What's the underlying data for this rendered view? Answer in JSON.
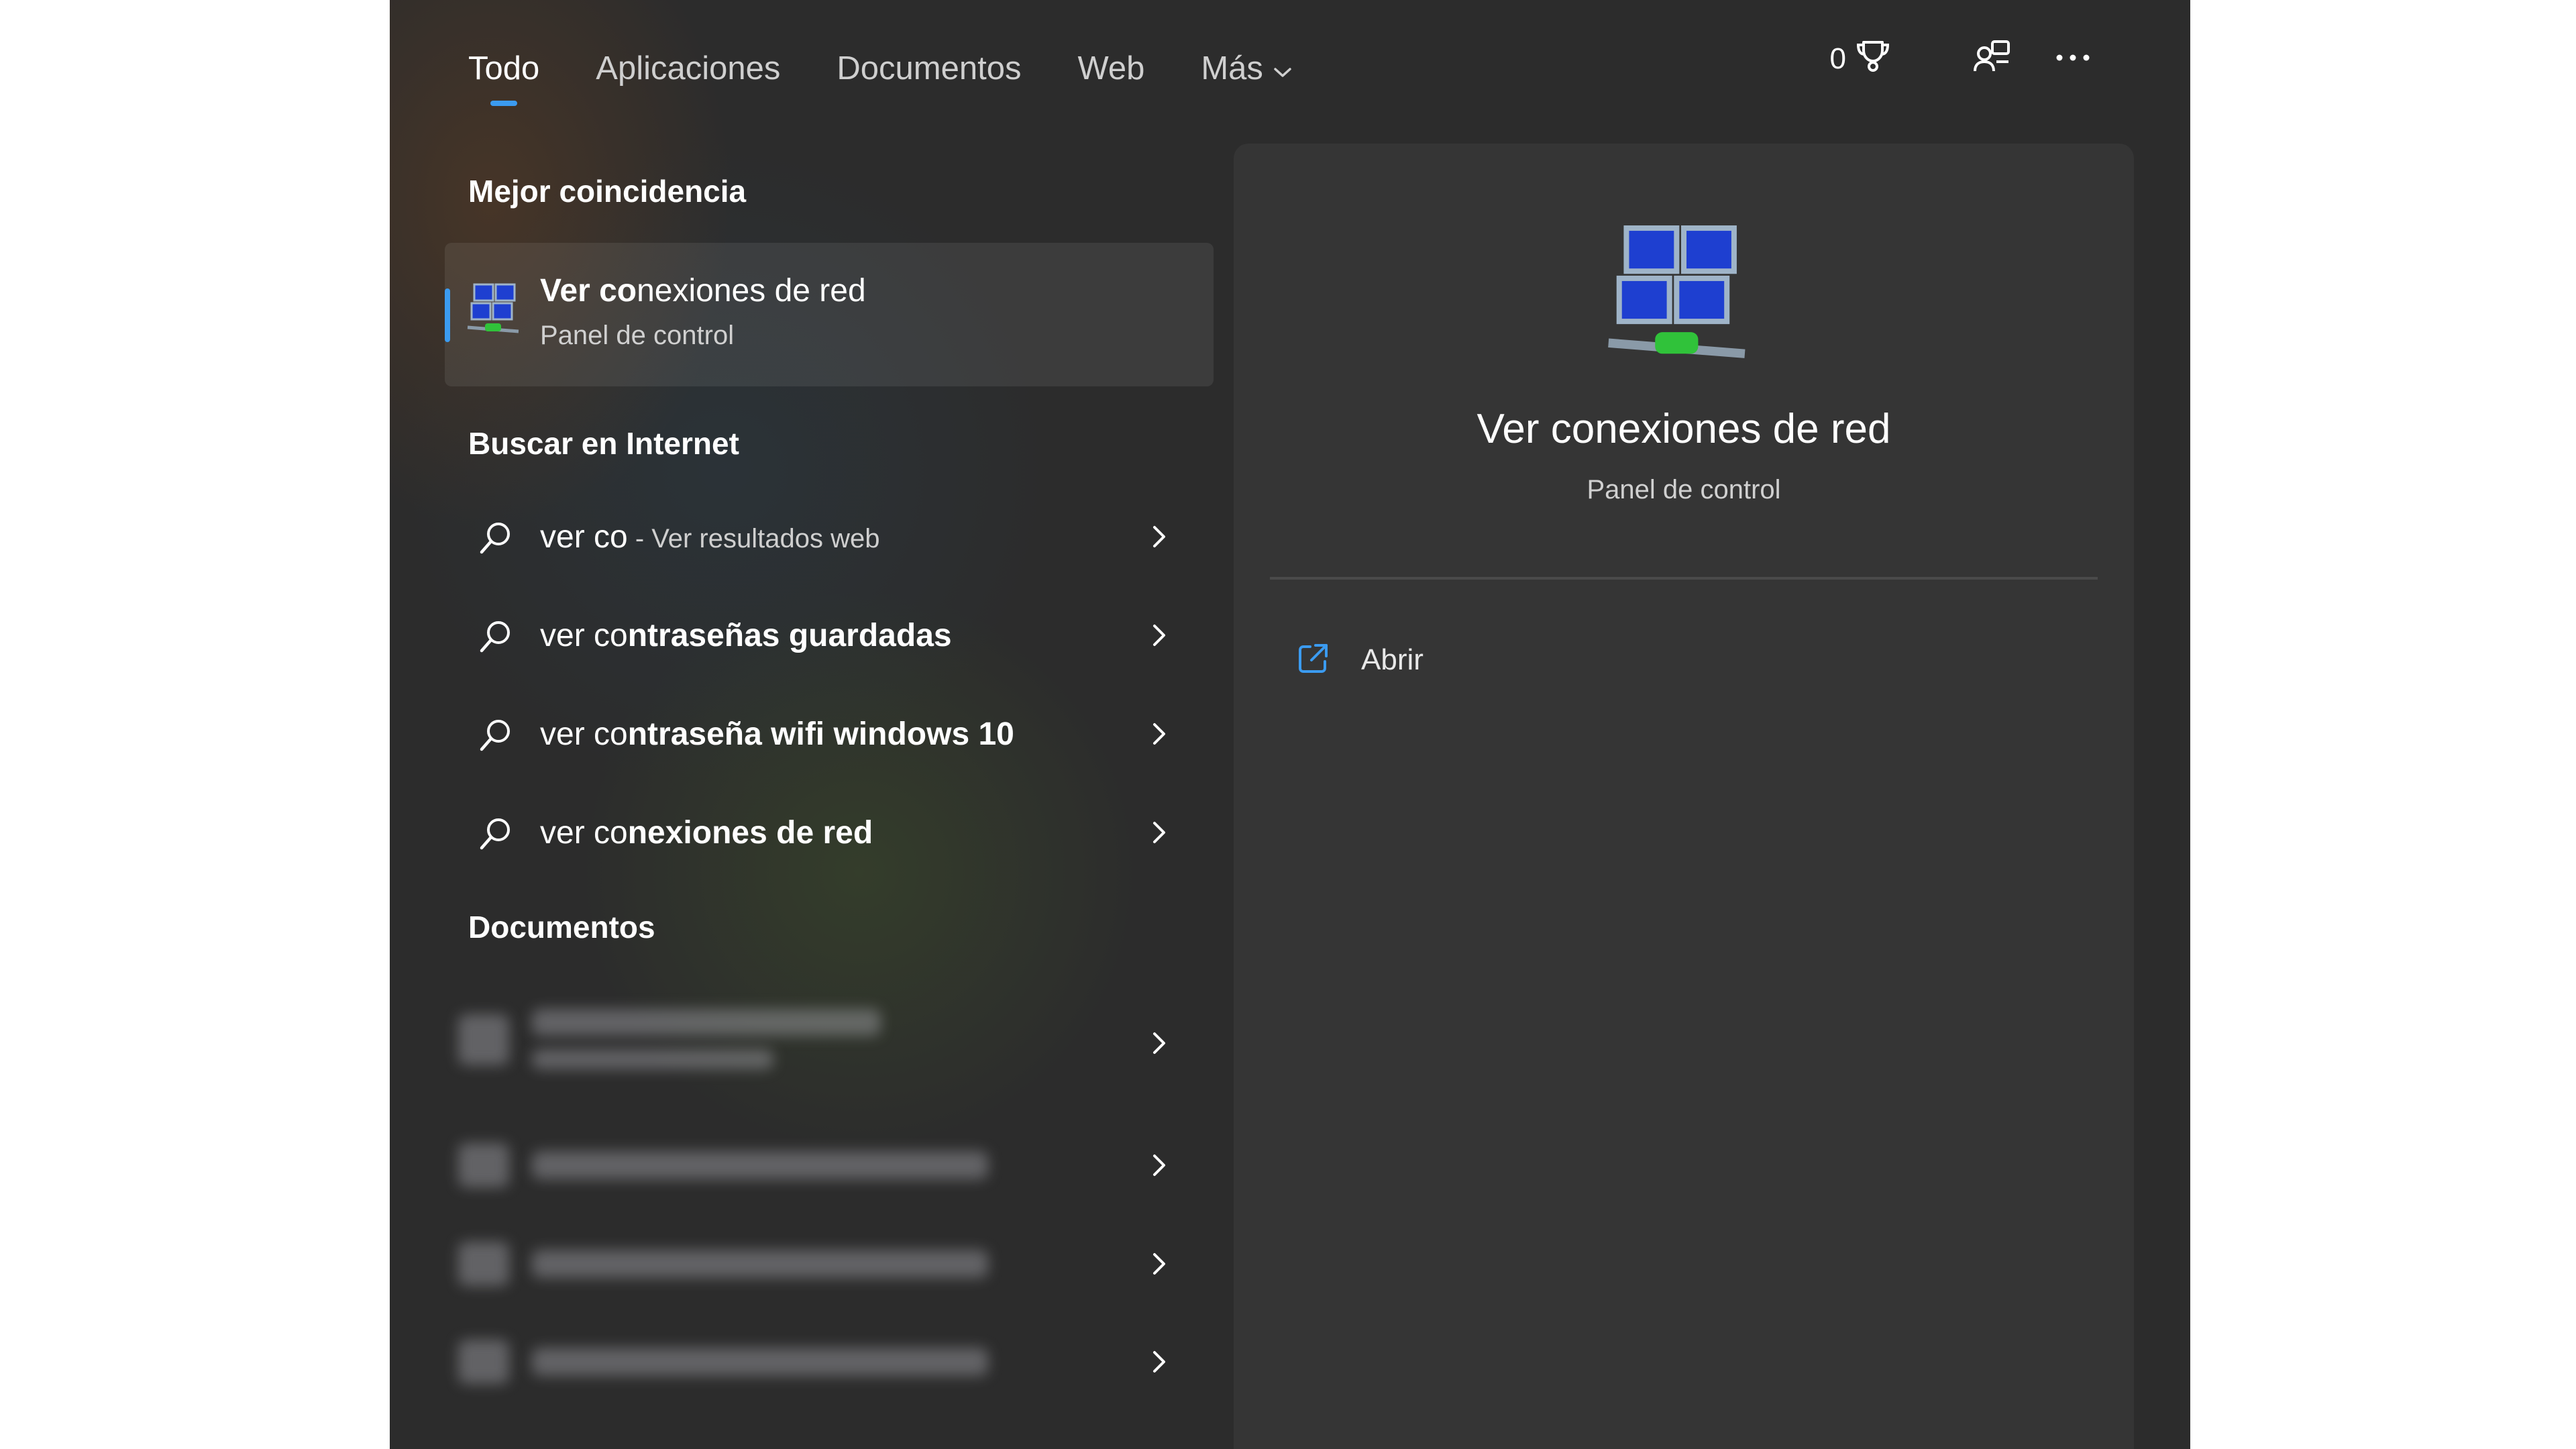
{
  "tabs": [
    {
      "label": "Todo",
      "active": true
    },
    {
      "label": "Aplicaciones"
    },
    {
      "label": "Documentos"
    },
    {
      "label": "Web"
    },
    {
      "label": "Más"
    }
  ],
  "top_actions": {
    "points": "0",
    "icons": [
      "trophy-icon",
      "account-switch-icon",
      "more-icon"
    ]
  },
  "sections": {
    "best_match": "Mejor coincidencia",
    "web": "Buscar en Internet",
    "documents": "Documentos"
  },
  "best_match": {
    "title_prefix": "Ver co",
    "title_rest": "nexiones de red",
    "subtitle": "Panel de control",
    "icon": "network-connections-icon"
  },
  "web_results": [
    {
      "typed": "ver co",
      "rest": "",
      "suffix": " - Ver resultados web"
    },
    {
      "typed": "ver co",
      "rest": "ntraseñas guardadas",
      "suffix": ""
    },
    {
      "typed": "ver co",
      "rest": "ntraseña wifi windows 10",
      "suffix": ""
    },
    {
      "typed": "ver co",
      "rest": "nexiones de red",
      "suffix": ""
    }
  ],
  "detail": {
    "title": "Ver conexiones de red",
    "subtitle": "Panel de control",
    "actions": [
      {
        "label": "Abrir",
        "icon": "open-external-icon"
      }
    ]
  },
  "colors": {
    "accent": "#3b9bf0",
    "background": "#2c2c2c"
  }
}
